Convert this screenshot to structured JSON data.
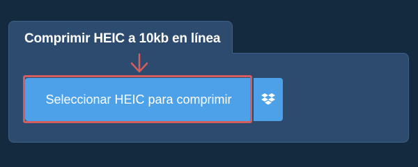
{
  "card": {
    "title": "Comprimir HEIC a 10kb en línea"
  },
  "upload": {
    "button_label": "Seleccionar HEIC para comprimir",
    "dropbox_icon": "dropbox-icon"
  },
  "annotation": {
    "arrow_icon": "arrow-down-icon",
    "highlight_color": "#d45d5d"
  },
  "colors": {
    "page_bg": "#142a3f",
    "card_bg": "#2d4b6e",
    "button_bg": "#4da1e8"
  }
}
